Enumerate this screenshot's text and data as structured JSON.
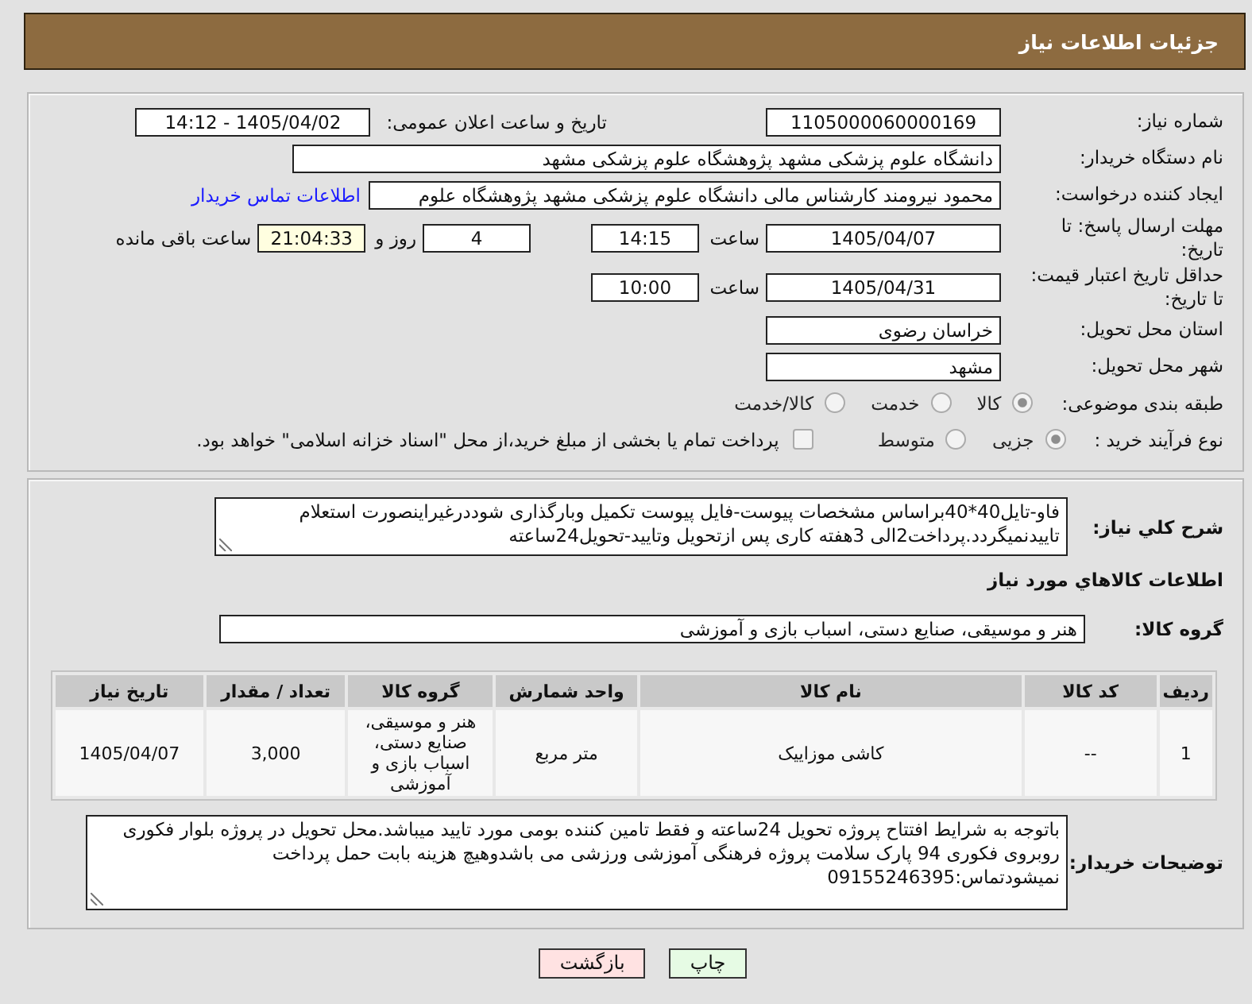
{
  "header": {
    "title": "جزئیات اطلاعات نیاز"
  },
  "need_info": {
    "need_number": {
      "label": "شماره نیاز:",
      "value": "1105000060000169"
    },
    "announcement": {
      "label": "تاریخ و ساعت اعلان عمومی:",
      "value": "1405/04/02 - 14:12"
    },
    "buyer_org": {
      "label": "نام دستگاه خریدار:",
      "value": "دانشگاه علوم پزشکی مشهد   پژوهشگاه علوم پزشکی مشهد"
    },
    "requester": {
      "label": "ایجاد کننده درخواست:",
      "value": "محمود نیرومند کارشناس مالی دانشگاه علوم پزشکی مشهد   پژوهشگاه علوم",
      "contact_link": "اطلاعات تماس خریدار"
    },
    "response_deadline": {
      "label": "مهلت ارسال پاسخ: تا تاریخ:",
      "date": "1405/04/07",
      "time_label": "ساعت",
      "time": "14:15",
      "days": "4",
      "days_label": "روز و",
      "remaining": "21:04:33",
      "remaining_label": "ساعت باقی مانده"
    },
    "price_validity": {
      "label": "حداقل تاریخ اعتبار قیمت: تا تاریخ:",
      "date": "1405/04/31",
      "time_label": "ساعت",
      "time": "10:00"
    },
    "delivery_province": {
      "label": "استان محل تحویل:",
      "value": "خراسان رضوی"
    },
    "delivery_city": {
      "label": "شهر محل تحویل:",
      "value": "مشهد"
    },
    "subject_category": {
      "label": "طبقه بندی موضوعی:",
      "options": [
        {
          "label": "کالا",
          "selected": true
        },
        {
          "label": "خدمت",
          "selected": false
        },
        {
          "label": "کالا/خدمت",
          "selected": false
        }
      ]
    },
    "purchase_process": {
      "label": "نوع فرآیند خرید :",
      "options": [
        {
          "label": "جزیی",
          "selected": true
        },
        {
          "label": "متوسط",
          "selected": false
        }
      ],
      "treasury_payment": {
        "label": "پرداخت تمام یا بخشی از مبلغ خرید،از محل \"اسناد خزانه اسلامی\" خواهد بود.",
        "checked": false
      }
    }
  },
  "goods": {
    "description": {
      "label": "شرح کلي نياز:",
      "value": "فاو-تایل40*40براساس مشخصات پیوست-فایل پیوست تکمیل وبارگذاری شوددرغیراینصورت استعلام تاییدنمیگردد.پرداخت2الی 3هفته کاری پس ازتحویل وتایید-تحویل24ساعته"
    },
    "section_title": "اطلاعات كالاهاي مورد نياز",
    "goods_group": {
      "label": "گروه کالا:",
      "value": "هنر و موسیقی، صنایع دستی، اسباب بازی و آموزشی"
    },
    "table": {
      "columns": [
        "ردیف",
        "کد کالا",
        "نام کالا",
        "واحد شمارش",
        "گروه کالا",
        "تعداد / مقدار",
        "تاریخ نیاز"
      ],
      "rows": [
        [
          "1",
          "--",
          "کاشی موزاییک",
          "متر مربع",
          "هنر و موسیقی، صنایع دستی، اسباب بازی و آموزشی",
          "3,000",
          "1405/04/07"
        ]
      ]
    },
    "buyer_notes": {
      "label": "توضیحات خریدار:",
      "value": "باتوجه به شرایط افتتاح پروژه تحویل 24ساعته و فقط تامین کننده بومی مورد تایید میباشد.محل تحویل در پروژه بلوار فکوری روبروی فکوری 94 پارک سلامت پروژه فرهنگی آموزشی ورزشی می باشدوهیچ هزینه بابت حمل  پرداخت نمیشودتماس:09155246395"
    }
  },
  "buttons": [
    {
      "label": "چاپ",
      "kind": "print"
    },
    {
      "label": "بازگشت",
      "kind": "back"
    }
  ]
}
